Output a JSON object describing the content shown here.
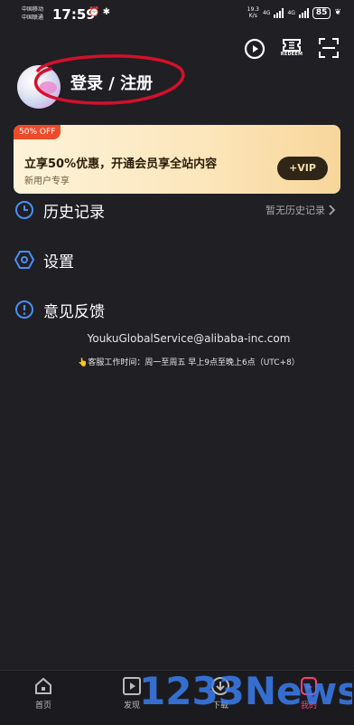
{
  "status_bar": {
    "carrier1": "中国移动",
    "carrier2": "中国联通",
    "time": "17:59",
    "net_speed_value": "19.3",
    "net_speed_unit": "K/s",
    "net_type1": "4G",
    "net_type2": "4G",
    "battery": "85"
  },
  "header": {
    "icons": [
      "play-circle-icon",
      "redeem-ticket-icon",
      "scan-icon"
    ],
    "redeem_label": "REDEEM"
  },
  "profile": {
    "login_text": "登录 / 注册"
  },
  "vip_banner": {
    "tag": "50% OFF",
    "title": "立享50%优惠，开通会员享全站内容",
    "subtitle": "新用户专享",
    "button": "+VIP"
  },
  "menu": {
    "history_label": "历史记录",
    "history_hint": "暂无历史记录",
    "settings_label": "设置",
    "feedback_label": "意见反馈"
  },
  "support": {
    "email": "YoukuGlobalService@alibaba-inc.com",
    "hours": "👆客服工作时间：周一至周五 早上9点至晚上6点（UTC+8）"
  },
  "tabbar": {
    "tabs": [
      {
        "label": "首页"
      },
      {
        "label": "发现"
      },
      {
        "label": "下载"
      },
      {
        "label": "我的"
      }
    ],
    "active_color": "#ff3f7a"
  },
  "watermark": {
    "text": "1233News"
  },
  "colors": {
    "background": "#1f1f24",
    "accent_blue": "#4b8ef5",
    "offer_red": "#ee4b2b",
    "annotation_red": "#d4102a"
  }
}
